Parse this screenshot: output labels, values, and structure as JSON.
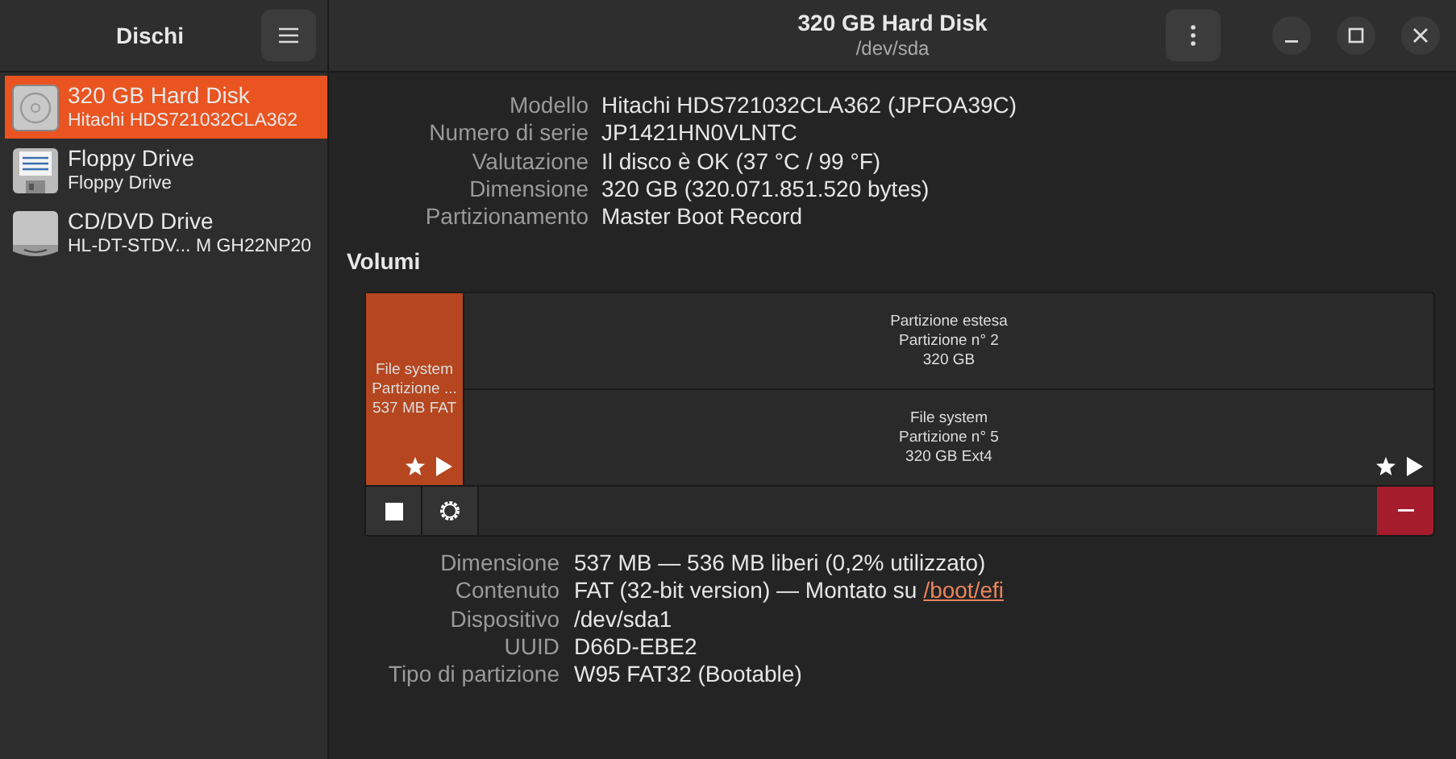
{
  "sidebar": {
    "title": "Dischi",
    "items": [
      {
        "kind": "hdd",
        "name": "320 GB Hard Disk",
        "detail": "Hitachi HDS721032CLA362",
        "selected": true
      },
      {
        "kind": "floppy",
        "name": "Floppy Drive",
        "detail": "Floppy Drive",
        "selected": false
      },
      {
        "kind": "optical",
        "name": "CD/DVD Drive",
        "detail": "HL-DT-STDV...  M GH22NP20",
        "selected": false
      }
    ]
  },
  "window": {
    "title": "320 GB Hard Disk",
    "subtitle": "/dev/sda"
  },
  "disk_info": [
    {
      "label": "Modello",
      "value": "Hitachi HDS721032CLA362 (JPFOA39C)"
    },
    {
      "label": "Numero di serie",
      "value": "JP1421HN0VLNTC"
    },
    {
      "label": "Valutazione",
      "value": "Il disco è OK (37 °C / 99 °F)"
    },
    {
      "label": "Dimensione",
      "value": "320 GB (320.071.851.520 bytes)"
    },
    {
      "label": "Partizionamento",
      "value": "Master Boot Record"
    }
  ],
  "volumes_title": "Volumi",
  "volumes": [
    {
      "lines": [
        "File system",
        "Partizione ...",
        "537 MB FAT"
      ],
      "selected": true,
      "bootable": true,
      "mounted": true
    },
    {
      "lines": [
        "Partizione estesa",
        "Partizione n° 2",
        "320 GB"
      ],
      "selected": false,
      "children": [
        {
          "lines": [
            "File system",
            "Partizione n° 5",
            "320 GB Ext4"
          ],
          "selected": false,
          "bootable": true,
          "mounted": true
        }
      ]
    }
  ],
  "partition_info": [
    {
      "label": "Dimensione",
      "value": "537 MB — 536 MB liberi (0,2% utilizzato)"
    },
    {
      "label": "Contenuto",
      "value": "FAT (32-bit version) — Montato su",
      "link": "/boot/efi"
    },
    {
      "label": "Dispositivo",
      "value": "/dev/sda1"
    },
    {
      "label": "UUID",
      "value": "D66D-EBE2"
    },
    {
      "label": "Tipo di partizione",
      "value": "W95 FAT32 (Bootable)"
    }
  ]
}
